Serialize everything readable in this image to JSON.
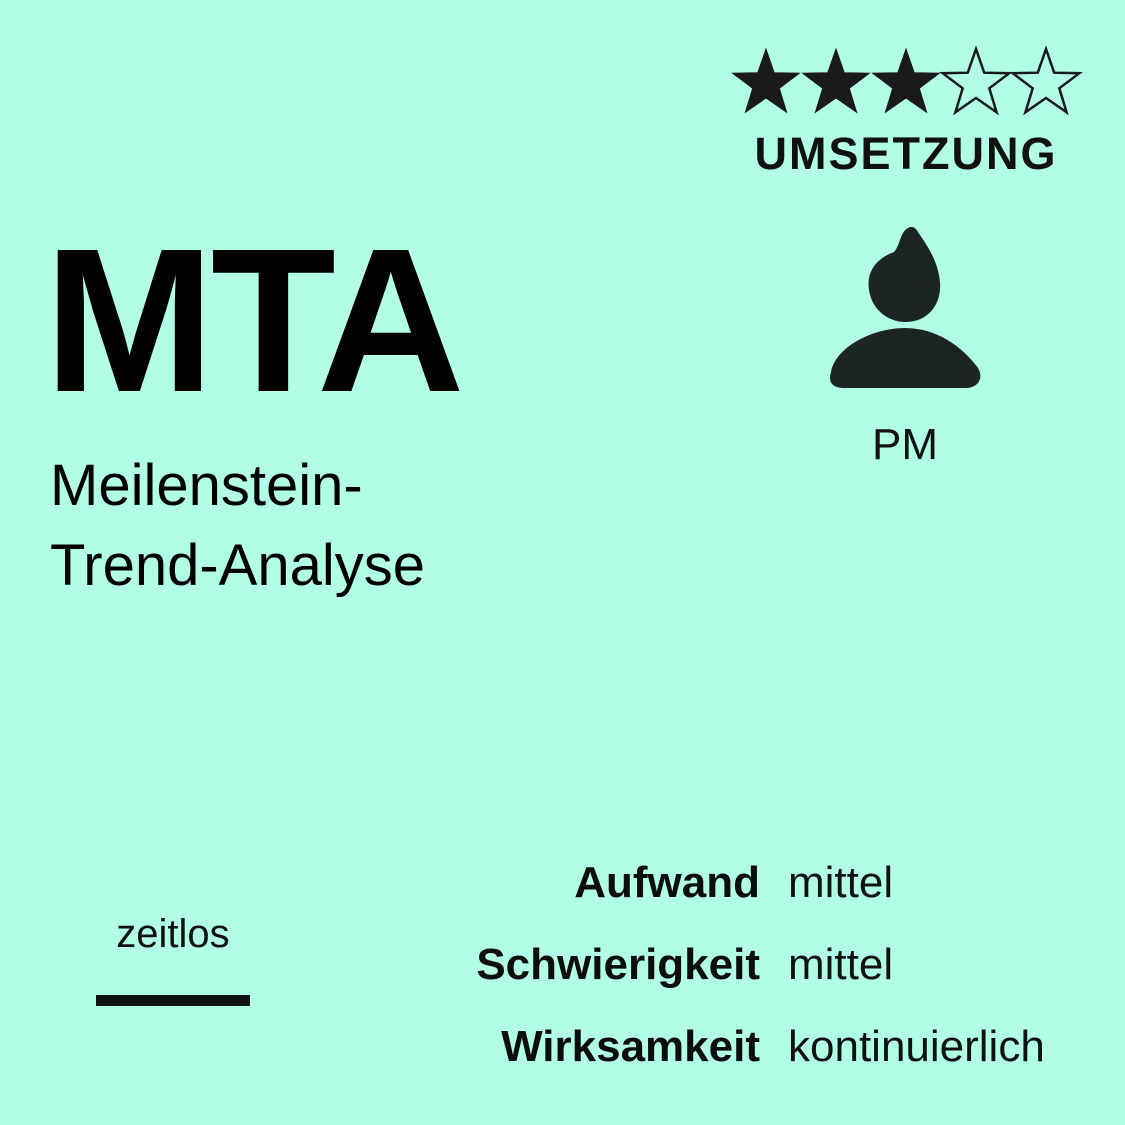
{
  "rating": {
    "filled": 3,
    "total": 5,
    "filled_color": "#1a1a1a",
    "empty_color": "#1a1a1a",
    "icon": "star-icon"
  },
  "category": "UMSETZUNG",
  "abbreviation": "MTA",
  "full_name": {
    "line1": "Meilenstein-",
    "line2": "Trend-Analyse"
  },
  "role": {
    "icon": "person-icon",
    "label": "PM"
  },
  "timeframe": "zeitlos",
  "metrics": [
    {
      "label": "Aufwand",
      "value": "mittel"
    },
    {
      "label": "Schwierigkeit",
      "value": "mittel"
    },
    {
      "label": "Wirksamkeit",
      "value": "kontinuierlich"
    }
  ],
  "colors": {
    "background": "#b1ffe4",
    "icon": "#1c2521",
    "text": "#000000"
  }
}
